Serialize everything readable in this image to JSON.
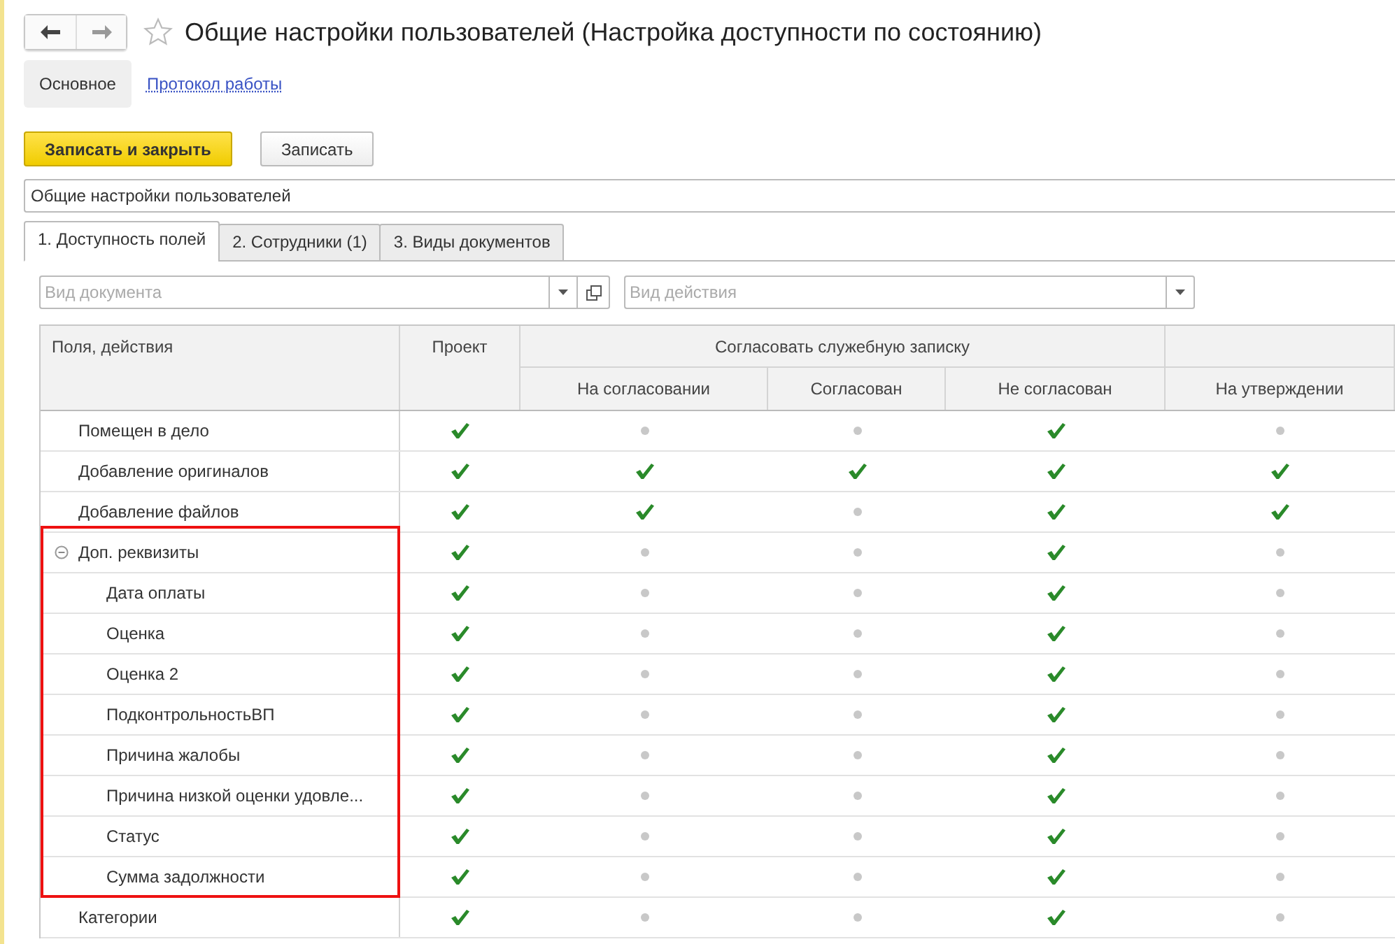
{
  "window": {
    "title": "Общие настройки пользователей (Настройка доступности по состоянию)",
    "favorite": false
  },
  "nav": [
    {
      "label": "Основное",
      "selected": true
    },
    {
      "label": "Протокол работы",
      "selected": false
    }
  ],
  "actions": [
    {
      "label": "Записать и закрыть",
      "kind": "primary"
    },
    {
      "label": "Записать",
      "kind": "normal"
    }
  ],
  "name_field": {
    "value": "Общие настройки пользователей"
  },
  "tabs": [
    {
      "label": "1. Доступность полей",
      "selected": true
    },
    {
      "label": "2. Сотрудники (1)",
      "selected": false
    },
    {
      "label": "3. Виды документов",
      "selected": false
    }
  ],
  "filters": [
    {
      "placeholder": "Вид документа",
      "open_button": true
    },
    {
      "placeholder": "Вид действия",
      "open_button": false
    }
  ],
  "table": {
    "name_column": "Поля, действия",
    "column_groups": [
      {
        "kind": "single",
        "columns": [
          "Проект"
        ]
      },
      {
        "kind": "grouped",
        "label": "Согласовать служебную записку",
        "columns": [
          "На согласовании",
          "Согласован",
          "Не согласован"
        ]
      },
      {
        "kind": "grouped",
        "columns": [
          "На утверждении"
        ]
      }
    ],
    "rows": [
      {
        "name": "Помещен в дело",
        "cells": [
          true,
          false,
          false,
          true,
          false
        ]
      },
      {
        "name": "Добавление оригиналов",
        "cells": [
          true,
          true,
          true,
          true,
          true
        ]
      },
      {
        "name": "Добавление файлов",
        "cells": [
          true,
          true,
          false,
          true,
          true
        ]
      },
      {
        "name": "Доп. реквизиты",
        "cells": [
          true,
          false,
          false,
          true,
          false
        ],
        "expanded": true,
        "highlighted": true,
        "children": [
          {
            "name": "Дата оплаты",
            "cells": [
              true,
              false,
              false,
              true,
              false
            ]
          },
          {
            "name": "Оценка",
            "cells": [
              true,
              false,
              false,
              true,
              false
            ]
          },
          {
            "name": "Оценка 2",
            "cells": [
              true,
              false,
              false,
              true,
              false
            ]
          },
          {
            "name": "ПодконтрольностьВП",
            "cells": [
              true,
              false,
              false,
              true,
              false
            ]
          },
          {
            "name": "Причина жалобы",
            "cells": [
              true,
              false,
              false,
              true,
              false
            ]
          },
          {
            "name": "Причина низкой оценки удовле...",
            "cells": [
              true,
              false,
              false,
              true,
              false
            ]
          },
          {
            "name": "Статус",
            "cells": [
              true,
              false,
              false,
              true,
              false
            ]
          },
          {
            "name": "Сумма задолжности",
            "cells": [
              true,
              false,
              false,
              true,
              false
            ]
          }
        ]
      },
      {
        "name": "Категории",
        "cells": [
          true,
          false,
          false,
          true,
          false
        ]
      }
    ]
  }
}
